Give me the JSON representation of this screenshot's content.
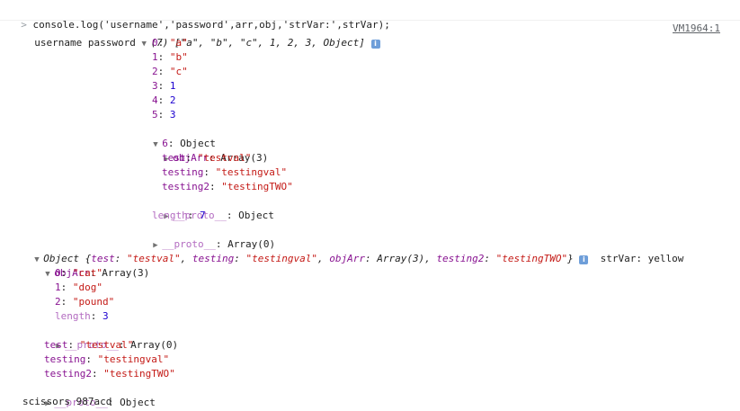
{
  "console": {
    "command_prompt": ">",
    "command": "console.log('username','password',arr,obj,'strVar:',strVar);",
    "source_link": "VM1964:1",
    "username": "username",
    "password": "password",
    "arr_header_count": "(7)",
    "arr_preview": "[\"a\", \"b\", \"c\", 1, 2, 3, Object]",
    "info_label": "i",
    "arr_items": [
      {
        "key": "0",
        "value": "\"a\""
      },
      {
        "key": "1",
        "value": "\"b\""
      },
      {
        "key": "2",
        "value": "\"c\""
      },
      {
        "key": "3",
        "value": "1"
      },
      {
        "key": "4",
        "value": "2"
      },
      {
        "key": "5",
        "value": "3"
      }
    ],
    "arr_obj_key": "6",
    "arr_obj_type": "Object",
    "nested_objarr_key": "objArr",
    "nested_objarr_value": "Array(3)",
    "nested_test_key": "test",
    "nested_test_value": "\"testval\"",
    "nested_testing_key": "testing",
    "nested_testing_value": "\"testingval\"",
    "nested_testing2_key": "testing2",
    "nested_testing2_value": "\"testingTWO\"",
    "proto_key": "__proto__",
    "proto_object": "Object",
    "proto_array": "Array(0)",
    "length_key": "length",
    "arr_length": "7",
    "obj_header": {
      "type": "Object",
      "open": "{",
      "k1": "test",
      "v1": "\"testval\"",
      "k2": "testing",
      "v2": "\"testingval\"",
      "k3": "objArr",
      "v3": "Array(3)",
      "k4": "testing2",
      "v4": "\"testingTWO\"",
      "close": "}"
    },
    "strvar_label": "strVar:",
    "strvar_value": "yellow",
    "objarr_items": [
      {
        "key": "0",
        "value": "\"cat\""
      },
      {
        "key": "1",
        "value": "\"dog\""
      },
      {
        "key": "2",
        "value": "\"pound\""
      }
    ],
    "objarr_length": "3",
    "last_line": "scissors 987acd"
  }
}
